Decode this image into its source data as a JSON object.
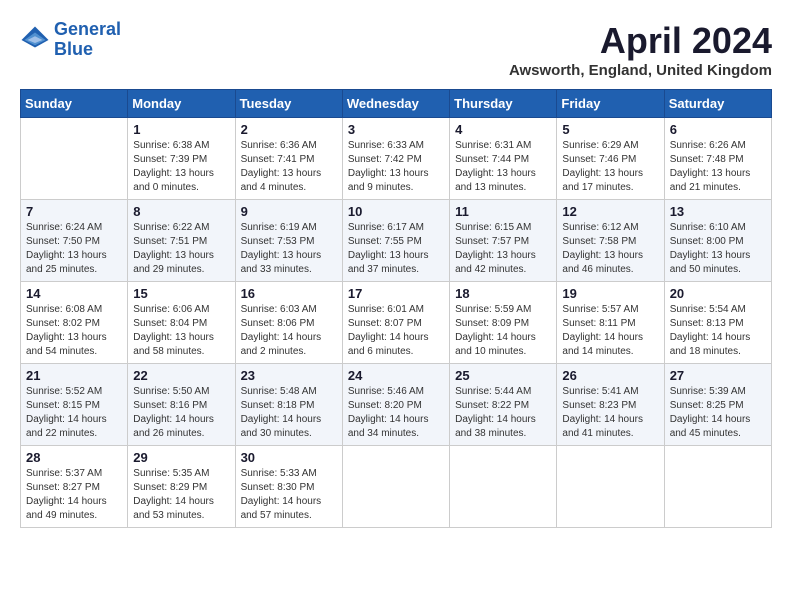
{
  "logo": {
    "line1": "General",
    "line2": "Blue"
  },
  "title": "April 2024",
  "subtitle": "Awsworth, England, United Kingdom",
  "days_of_week": [
    "Sunday",
    "Monday",
    "Tuesday",
    "Wednesday",
    "Thursday",
    "Friday",
    "Saturday"
  ],
  "weeks": [
    [
      {
        "day": "",
        "sunrise": "",
        "sunset": "",
        "daylight": ""
      },
      {
        "day": "1",
        "sunrise": "Sunrise: 6:38 AM",
        "sunset": "Sunset: 7:39 PM",
        "daylight": "Daylight: 13 hours and 0 minutes."
      },
      {
        "day": "2",
        "sunrise": "Sunrise: 6:36 AM",
        "sunset": "Sunset: 7:41 PM",
        "daylight": "Daylight: 13 hours and 4 minutes."
      },
      {
        "day": "3",
        "sunrise": "Sunrise: 6:33 AM",
        "sunset": "Sunset: 7:42 PM",
        "daylight": "Daylight: 13 hours and 9 minutes."
      },
      {
        "day": "4",
        "sunrise": "Sunrise: 6:31 AM",
        "sunset": "Sunset: 7:44 PM",
        "daylight": "Daylight: 13 hours and 13 minutes."
      },
      {
        "day": "5",
        "sunrise": "Sunrise: 6:29 AM",
        "sunset": "Sunset: 7:46 PM",
        "daylight": "Daylight: 13 hours and 17 minutes."
      },
      {
        "day": "6",
        "sunrise": "Sunrise: 6:26 AM",
        "sunset": "Sunset: 7:48 PM",
        "daylight": "Daylight: 13 hours and 21 minutes."
      }
    ],
    [
      {
        "day": "7",
        "sunrise": "Sunrise: 6:24 AM",
        "sunset": "Sunset: 7:50 PM",
        "daylight": "Daylight: 13 hours and 25 minutes."
      },
      {
        "day": "8",
        "sunrise": "Sunrise: 6:22 AM",
        "sunset": "Sunset: 7:51 PM",
        "daylight": "Daylight: 13 hours and 29 minutes."
      },
      {
        "day": "9",
        "sunrise": "Sunrise: 6:19 AM",
        "sunset": "Sunset: 7:53 PM",
        "daylight": "Daylight: 13 hours and 33 minutes."
      },
      {
        "day": "10",
        "sunrise": "Sunrise: 6:17 AM",
        "sunset": "Sunset: 7:55 PM",
        "daylight": "Daylight: 13 hours and 37 minutes."
      },
      {
        "day": "11",
        "sunrise": "Sunrise: 6:15 AM",
        "sunset": "Sunset: 7:57 PM",
        "daylight": "Daylight: 13 hours and 42 minutes."
      },
      {
        "day": "12",
        "sunrise": "Sunrise: 6:12 AM",
        "sunset": "Sunset: 7:58 PM",
        "daylight": "Daylight: 13 hours and 46 minutes."
      },
      {
        "day": "13",
        "sunrise": "Sunrise: 6:10 AM",
        "sunset": "Sunset: 8:00 PM",
        "daylight": "Daylight: 13 hours and 50 minutes."
      }
    ],
    [
      {
        "day": "14",
        "sunrise": "Sunrise: 6:08 AM",
        "sunset": "Sunset: 8:02 PM",
        "daylight": "Daylight: 13 hours and 54 minutes."
      },
      {
        "day": "15",
        "sunrise": "Sunrise: 6:06 AM",
        "sunset": "Sunset: 8:04 PM",
        "daylight": "Daylight: 13 hours and 58 minutes."
      },
      {
        "day": "16",
        "sunrise": "Sunrise: 6:03 AM",
        "sunset": "Sunset: 8:06 PM",
        "daylight": "Daylight: 14 hours and 2 minutes."
      },
      {
        "day": "17",
        "sunrise": "Sunrise: 6:01 AM",
        "sunset": "Sunset: 8:07 PM",
        "daylight": "Daylight: 14 hours and 6 minutes."
      },
      {
        "day": "18",
        "sunrise": "Sunrise: 5:59 AM",
        "sunset": "Sunset: 8:09 PM",
        "daylight": "Daylight: 14 hours and 10 minutes."
      },
      {
        "day": "19",
        "sunrise": "Sunrise: 5:57 AM",
        "sunset": "Sunset: 8:11 PM",
        "daylight": "Daylight: 14 hours and 14 minutes."
      },
      {
        "day": "20",
        "sunrise": "Sunrise: 5:54 AM",
        "sunset": "Sunset: 8:13 PM",
        "daylight": "Daylight: 14 hours and 18 minutes."
      }
    ],
    [
      {
        "day": "21",
        "sunrise": "Sunrise: 5:52 AM",
        "sunset": "Sunset: 8:15 PM",
        "daylight": "Daylight: 14 hours and 22 minutes."
      },
      {
        "day": "22",
        "sunrise": "Sunrise: 5:50 AM",
        "sunset": "Sunset: 8:16 PM",
        "daylight": "Daylight: 14 hours and 26 minutes."
      },
      {
        "day": "23",
        "sunrise": "Sunrise: 5:48 AM",
        "sunset": "Sunset: 8:18 PM",
        "daylight": "Daylight: 14 hours and 30 minutes."
      },
      {
        "day": "24",
        "sunrise": "Sunrise: 5:46 AM",
        "sunset": "Sunset: 8:20 PM",
        "daylight": "Daylight: 14 hours and 34 minutes."
      },
      {
        "day": "25",
        "sunrise": "Sunrise: 5:44 AM",
        "sunset": "Sunset: 8:22 PM",
        "daylight": "Daylight: 14 hours and 38 minutes."
      },
      {
        "day": "26",
        "sunrise": "Sunrise: 5:41 AM",
        "sunset": "Sunset: 8:23 PM",
        "daylight": "Daylight: 14 hours and 41 minutes."
      },
      {
        "day": "27",
        "sunrise": "Sunrise: 5:39 AM",
        "sunset": "Sunset: 8:25 PM",
        "daylight": "Daylight: 14 hours and 45 minutes."
      }
    ],
    [
      {
        "day": "28",
        "sunrise": "Sunrise: 5:37 AM",
        "sunset": "Sunset: 8:27 PM",
        "daylight": "Daylight: 14 hours and 49 minutes."
      },
      {
        "day": "29",
        "sunrise": "Sunrise: 5:35 AM",
        "sunset": "Sunset: 8:29 PM",
        "daylight": "Daylight: 14 hours and 53 minutes."
      },
      {
        "day": "30",
        "sunrise": "Sunrise: 5:33 AM",
        "sunset": "Sunset: 8:30 PM",
        "daylight": "Daylight: 14 hours and 57 minutes."
      },
      {
        "day": "",
        "sunrise": "",
        "sunset": "",
        "daylight": ""
      },
      {
        "day": "",
        "sunrise": "",
        "sunset": "",
        "daylight": ""
      },
      {
        "day": "",
        "sunrise": "",
        "sunset": "",
        "daylight": ""
      },
      {
        "day": "",
        "sunrise": "",
        "sunset": "",
        "daylight": ""
      }
    ]
  ]
}
